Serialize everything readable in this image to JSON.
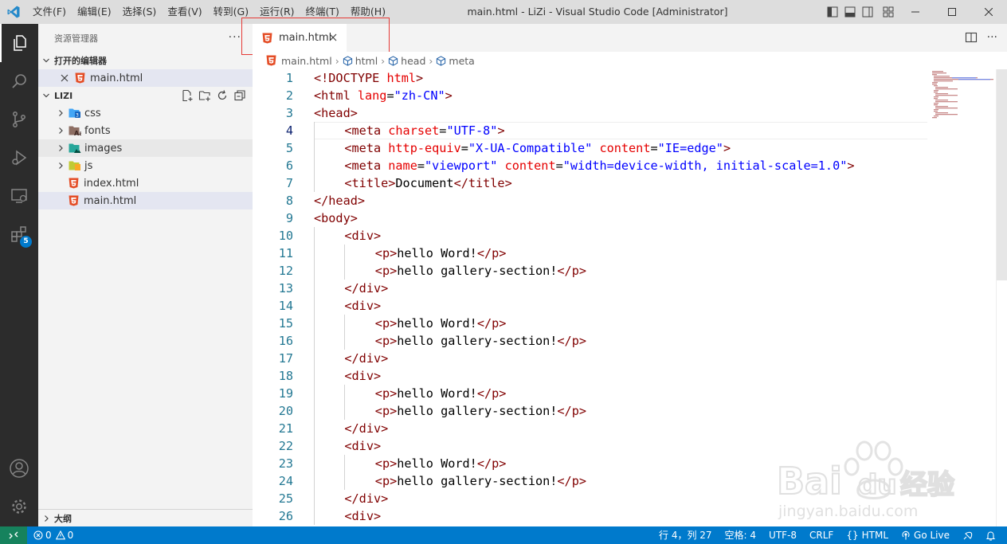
{
  "titlebar": {
    "menus": [
      "文件(F)",
      "编辑(E)",
      "选择(S)",
      "查看(V)",
      "转到(G)",
      "运行(R)",
      "终端(T)",
      "帮助(H)"
    ],
    "title": "main.html - LiZi - Visual Studio Code [Administrator]"
  },
  "activitybar": {
    "items": [
      "explorer-icon",
      "search-icon",
      "source-control-icon",
      "run-debug-icon",
      "remote-explorer-icon",
      "extensions-icon",
      "account-icon",
      "manage-gear-icon"
    ],
    "extensions_badge": "5"
  },
  "sidebar": {
    "title": "资源管理器",
    "open_editors": {
      "label": "打开的编辑器",
      "files": [
        "main.html"
      ]
    },
    "workspace": {
      "label": "LIZI",
      "items": [
        {
          "name": "css",
          "type": "folder"
        },
        {
          "name": "fonts",
          "type": "folder"
        },
        {
          "name": "images",
          "type": "folder"
        },
        {
          "name": "js",
          "type": "folder"
        },
        {
          "name": "index.html",
          "type": "html"
        },
        {
          "name": "main.html",
          "type": "html"
        }
      ]
    },
    "outline_label": "大纲"
  },
  "editor": {
    "tab_label": "main.html",
    "breadcrumbs": [
      "main.html",
      "html",
      "head",
      "meta"
    ],
    "current_line": 4,
    "lines": [
      {
        "n": "1",
        "indent": 0,
        "parts": [
          [
            "t",
            "<!DOCTYPE "
          ],
          [
            "a",
            "html"
          ],
          [
            "t",
            ">"
          ]
        ]
      },
      {
        "n": "2",
        "indent": 0,
        "parts": [
          [
            "t",
            "<html "
          ],
          [
            "a",
            "lang"
          ],
          [
            "x",
            "="
          ],
          [
            "v",
            "\"zh-CN\""
          ],
          [
            "t",
            ">"
          ]
        ]
      },
      {
        "n": "3",
        "indent": 0,
        "parts": [
          [
            "t",
            "<head>"
          ]
        ]
      },
      {
        "n": "4",
        "indent": 1,
        "parts": [
          [
            "t",
            "<meta "
          ],
          [
            "a",
            "charset"
          ],
          [
            "x",
            "="
          ],
          [
            "v",
            "\"UTF-8\""
          ],
          [
            "t",
            ">"
          ]
        ]
      },
      {
        "n": "5",
        "indent": 1,
        "parts": [
          [
            "t",
            "<meta "
          ],
          [
            "a",
            "http-equiv"
          ],
          [
            "x",
            "="
          ],
          [
            "v",
            "\"X-UA-Compatible\""
          ],
          [
            "x",
            " "
          ],
          [
            "a",
            "content"
          ],
          [
            "x",
            "="
          ],
          [
            "v",
            "\"IE=edge\""
          ],
          [
            "t",
            ">"
          ]
        ]
      },
      {
        "n": "6",
        "indent": 1,
        "parts": [
          [
            "t",
            "<meta "
          ],
          [
            "a",
            "name"
          ],
          [
            "x",
            "="
          ],
          [
            "v",
            "\"viewport\""
          ],
          [
            "x",
            " "
          ],
          [
            "a",
            "content"
          ],
          [
            "x",
            "="
          ],
          [
            "v",
            "\"width=device-width, initial-scale=1.0\""
          ],
          [
            "t",
            ">"
          ]
        ]
      },
      {
        "n": "7",
        "indent": 1,
        "parts": [
          [
            "t",
            "<title>"
          ],
          [
            "x",
            "Document"
          ],
          [
            "t",
            "</title>"
          ]
        ]
      },
      {
        "n": "8",
        "indent": 0,
        "parts": [
          [
            "t",
            "</head>"
          ]
        ]
      },
      {
        "n": "9",
        "indent": 0,
        "parts": [
          [
            "t",
            "<body>"
          ]
        ]
      },
      {
        "n": "10",
        "indent": 1,
        "parts": [
          [
            "t",
            "<div>"
          ]
        ]
      },
      {
        "n": "11",
        "indent": 2,
        "parts": [
          [
            "t",
            "<p>"
          ],
          [
            "x",
            "hello Word!"
          ],
          [
            "t",
            "</p>"
          ]
        ]
      },
      {
        "n": "12",
        "indent": 2,
        "parts": [
          [
            "t",
            "<p>"
          ],
          [
            "x",
            "hello gallery-section!"
          ],
          [
            "t",
            "</p>"
          ]
        ]
      },
      {
        "n": "13",
        "indent": 1,
        "parts": [
          [
            "t",
            "</div>"
          ]
        ]
      },
      {
        "n": "14",
        "indent": 1,
        "parts": [
          [
            "t",
            "<div>"
          ]
        ]
      },
      {
        "n": "15",
        "indent": 2,
        "parts": [
          [
            "t",
            "<p>"
          ],
          [
            "x",
            "hello Word!"
          ],
          [
            "t",
            "</p>"
          ]
        ]
      },
      {
        "n": "16",
        "indent": 2,
        "parts": [
          [
            "t",
            "<p>"
          ],
          [
            "x",
            "hello gallery-section!"
          ],
          [
            "t",
            "</p>"
          ]
        ]
      },
      {
        "n": "17",
        "indent": 1,
        "parts": [
          [
            "t",
            "</div>"
          ]
        ]
      },
      {
        "n": "18",
        "indent": 1,
        "parts": [
          [
            "t",
            "<div>"
          ]
        ]
      },
      {
        "n": "19",
        "indent": 2,
        "parts": [
          [
            "t",
            "<p>"
          ],
          [
            "x",
            "hello Word!"
          ],
          [
            "t",
            "</p>"
          ]
        ]
      },
      {
        "n": "20",
        "indent": 2,
        "parts": [
          [
            "t",
            "<p>"
          ],
          [
            "x",
            "hello gallery-section!"
          ],
          [
            "t",
            "</p>"
          ]
        ]
      },
      {
        "n": "21",
        "indent": 1,
        "parts": [
          [
            "t",
            "</div>"
          ]
        ]
      },
      {
        "n": "22",
        "indent": 1,
        "parts": [
          [
            "t",
            "<div>"
          ]
        ]
      },
      {
        "n": "23",
        "indent": 2,
        "parts": [
          [
            "t",
            "<p>"
          ],
          [
            "x",
            "hello Word!"
          ],
          [
            "t",
            "</p>"
          ]
        ]
      },
      {
        "n": "24",
        "indent": 2,
        "parts": [
          [
            "t",
            "<p>"
          ],
          [
            "x",
            "hello gallery-section!"
          ],
          [
            "t",
            "</p>"
          ]
        ]
      },
      {
        "n": "25",
        "indent": 1,
        "parts": [
          [
            "t",
            "</div>"
          ]
        ]
      },
      {
        "n": "26",
        "indent": 1,
        "parts": [
          [
            "t",
            "<div>"
          ]
        ]
      }
    ]
  },
  "statusbar": {
    "errors": "0",
    "warnings": "0",
    "position": "行 4，列 27",
    "spaces": "空格: 4",
    "encoding": "UTF-8",
    "eol": "CRLF",
    "language": "HTML",
    "go_live": "Go Live"
  },
  "watermark": {
    "brand": "Baidu经验",
    "url": "jingyan.baidu.com"
  },
  "colors": {
    "accent": "#007acc",
    "tag": "#800000",
    "attribute": "#e50000",
    "value": "#0000ff",
    "line_number": "#237893",
    "highlight_box": "#e53935"
  }
}
